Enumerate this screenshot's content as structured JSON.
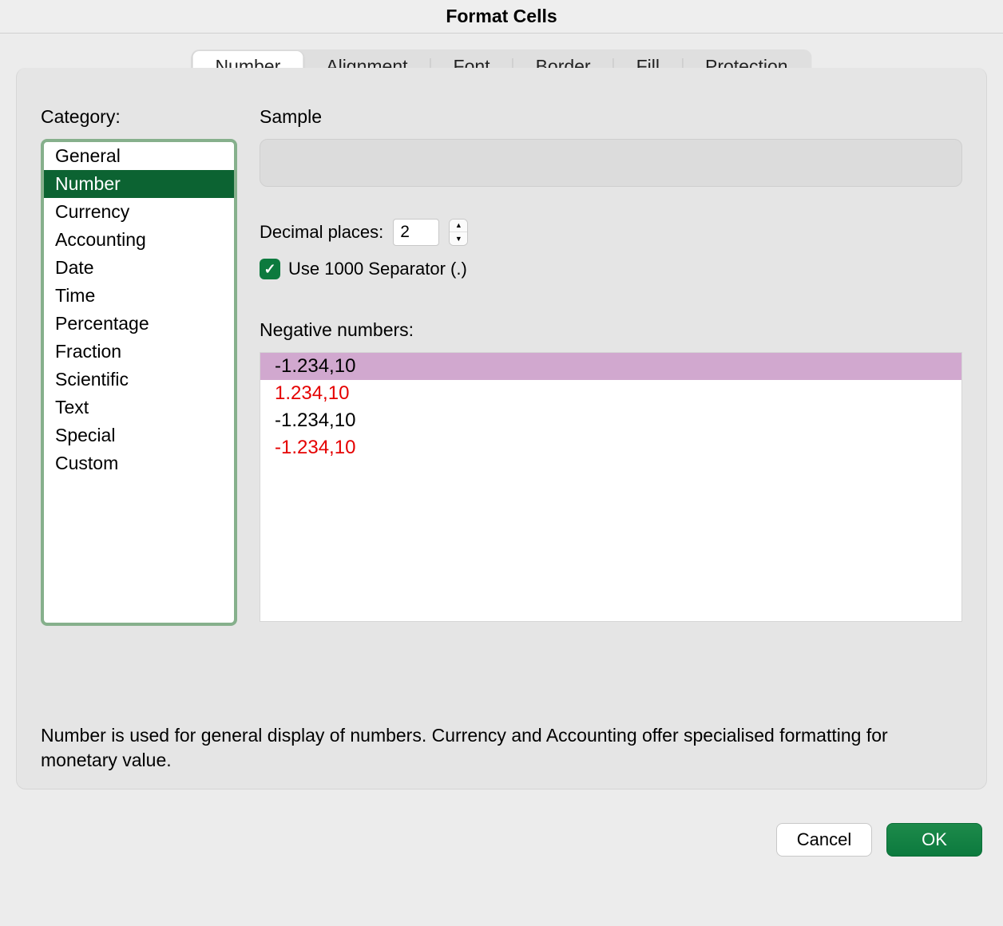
{
  "title": "Format Cells",
  "tabs": [
    "Number",
    "Alignment",
    "Font",
    "Border",
    "Fill",
    "Protection"
  ],
  "active_tab_index": 0,
  "category_label": "Category:",
  "categories": [
    "General",
    "Number",
    "Currency",
    "Accounting",
    "Date",
    "Time",
    "Percentage",
    "Fraction",
    "Scientific",
    "Text",
    "Special",
    "Custom"
  ],
  "selected_category_index": 1,
  "sample_label": "Sample",
  "decimal_places_label": "Decimal places:",
  "decimal_places_value": "2",
  "thousand_sep_checked": true,
  "thousand_sep_label": "Use 1000 Separator (.)",
  "negative_label": "Negative numbers:",
  "negative_options": [
    {
      "text": "-1.234,10",
      "red": false
    },
    {
      "text": "1.234,10",
      "red": true
    },
    {
      "text": "-1.234,10",
      "red": false
    },
    {
      "text": "-1.234,10",
      "red": true
    }
  ],
  "selected_negative_index": 0,
  "description": "Number is used for general display of numbers.  Currency and Accounting offer specialised formatting for monetary value.",
  "buttons": {
    "cancel": "Cancel",
    "ok": "OK"
  }
}
